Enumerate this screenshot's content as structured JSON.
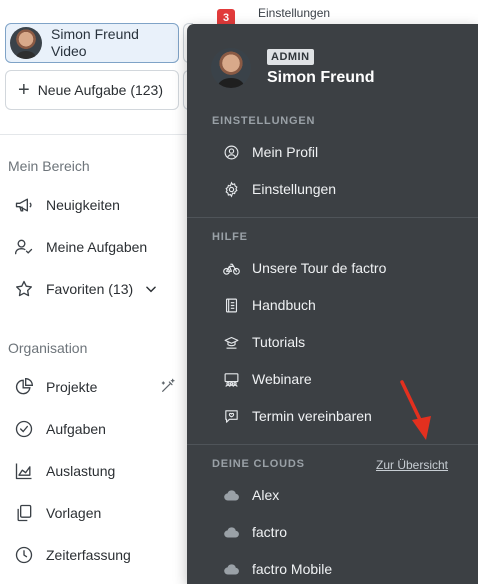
{
  "topbar": {
    "notification_count": "3",
    "peek_label": "Einstellungen"
  },
  "sidebar": {
    "user_name": "Simon Freund Video",
    "new_task_label": "Neue Aufgabe (123)",
    "sections": {
      "mein_bereich": {
        "title": "Mein Bereich",
        "items": [
          {
            "label": "Neuigkeiten",
            "icon": "megaphone-icon"
          },
          {
            "label": "Meine Aufgaben",
            "icon": "user-check-icon"
          },
          {
            "label": "Favoriten (13)",
            "icon": "star-icon"
          }
        ]
      },
      "organisation": {
        "title": "Organisation",
        "items": [
          {
            "label": "Projekte",
            "icon": "pie-chart-icon"
          },
          {
            "label": "Aufgaben",
            "icon": "check-circle-icon"
          },
          {
            "label": "Auslastung",
            "icon": "area-chart-icon"
          },
          {
            "label": "Vorlagen",
            "icon": "copy-icon"
          },
          {
            "label": "Zeiterfassung",
            "icon": "clock-icon"
          }
        ]
      }
    }
  },
  "menu": {
    "role": "ADMIN",
    "name": "Simon Freund",
    "settings": {
      "title": "EINSTELLUNGEN",
      "items": [
        {
          "label": "Mein Profil",
          "icon": "user-circle-icon"
        },
        {
          "label": "Einstellungen",
          "icon": "gear-icon"
        }
      ]
    },
    "help": {
      "title": "HILFE",
      "items": [
        {
          "label": "Unsere Tour de factro",
          "icon": "bicycle-icon"
        },
        {
          "label": "Handbuch",
          "icon": "book-icon"
        },
        {
          "label": "Tutorials",
          "icon": "graduation-icon"
        },
        {
          "label": "Webinare",
          "icon": "webinar-icon"
        },
        {
          "label": "Termin vereinbaren",
          "icon": "chat-calendar-icon"
        }
      ]
    },
    "clouds": {
      "title": "DEINE CLOUDS",
      "overview_link": "Zur Übersicht",
      "items": [
        {
          "label": "Alex",
          "icon": "cloud-icon"
        },
        {
          "label": "factro",
          "icon": "cloud-icon"
        },
        {
          "label": "factro Mobile",
          "icon": "cloud-icon"
        }
      ]
    }
  },
  "colors": {
    "menu_bg": "#3c4044",
    "accent_arrow": "#e3301f",
    "badge": "#e23b3b",
    "selected_card_bg": "#e9f1fa"
  }
}
